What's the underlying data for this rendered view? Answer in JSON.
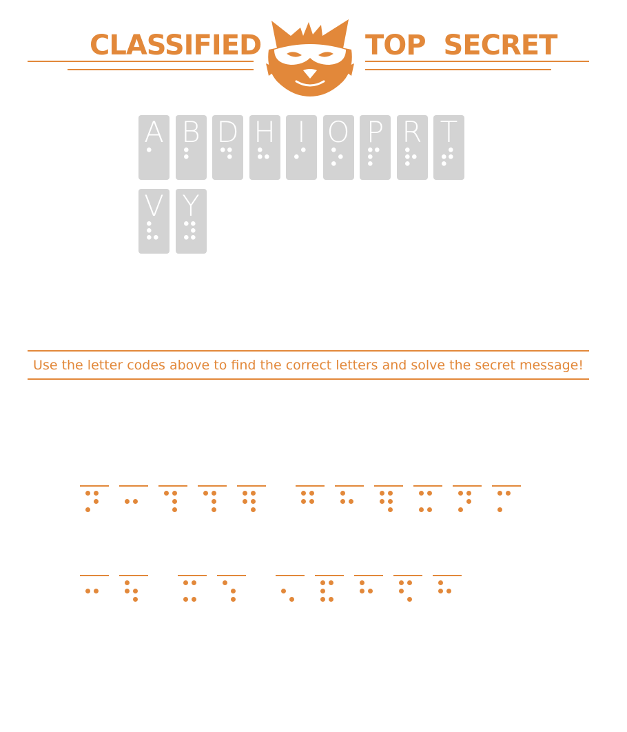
{
  "header": {
    "left_text": "CLASSIFIED",
    "right_text": "TOP  SECRET",
    "logo_icon": "masked-fox-icon",
    "accent_color": "#e2883a"
  },
  "legend": [
    {
      "letter": "A",
      "dots": [
        1
      ]
    },
    {
      "letter": "B",
      "dots": [
        1,
        2
      ]
    },
    {
      "letter": "D",
      "dots": [
        1,
        4,
        5
      ]
    },
    {
      "letter": "H",
      "dots": [
        1,
        2,
        5
      ]
    },
    {
      "letter": "I",
      "dots": [
        2,
        4
      ]
    },
    {
      "letter": "O",
      "dots": [
        1,
        3,
        5
      ]
    },
    {
      "letter": "P",
      "dots": [
        1,
        2,
        3,
        4
      ]
    },
    {
      "letter": "R",
      "dots": [
        1,
        2,
        3,
        5
      ]
    },
    {
      "letter": "T",
      "dots": [
        2,
        3,
        4,
        5
      ]
    },
    {
      "letter": "V",
      "dots": [
        1,
        2,
        3,
        6
      ]
    },
    {
      "letter": "Y",
      "dots": [
        1,
        3,
        4,
        5,
        6
      ]
    }
  ],
  "instruction": "Use the letter codes above to find the correct letters and solve the secret message!",
  "puzzle": {
    "line1": [
      [
        1,
        4,
        5,
        3
      ],
      [
        2,
        5
      ],
      [
        1,
        4,
        5,
        6
      ],
      [
        1,
        4,
        5,
        6
      ],
      [
        1,
        2,
        4,
        5,
        6
      ],
      null,
      [
        1,
        2,
        4,
        5
      ],
      [
        1,
        2,
        5
      ],
      [
        1,
        2,
        4,
        5,
        6
      ],
      [
        1,
        4,
        3,
        6
      ],
      [
        1,
        4,
        5,
        3
      ],
      [
        1,
        4,
        3
      ]
    ],
    "line2": [
      [
        2,
        5
      ],
      [
        1,
        2,
        5,
        6
      ],
      null,
      [
        1,
        4,
        3,
        6
      ],
      [
        1,
        5,
        6
      ],
      null,
      [
        2,
        6
      ],
      [
        1,
        2,
        4,
        3,
        6
      ],
      [
        1,
        2,
        5
      ],
      [
        1,
        2,
        4,
        6
      ],
      [
        1,
        2,
        5
      ]
    ]
  }
}
